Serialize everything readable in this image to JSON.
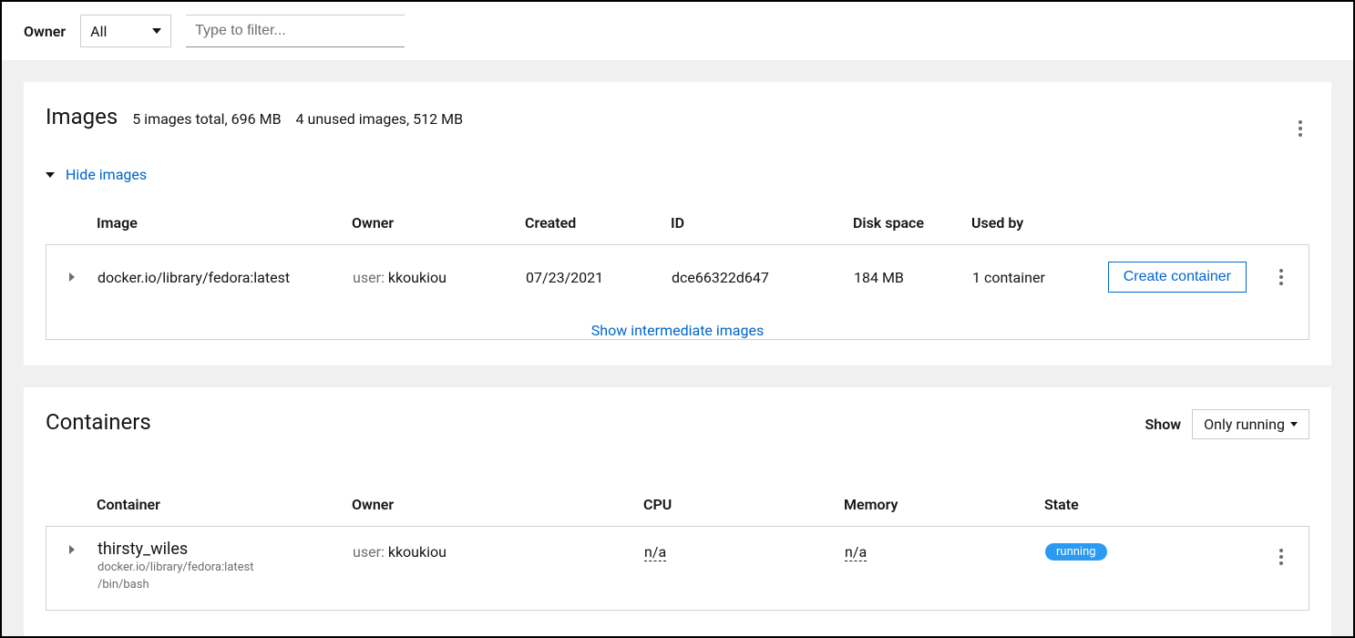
{
  "toolbar": {
    "owner_label": "Owner",
    "owner_value": "All",
    "filter_placeholder": "Type to filter..."
  },
  "images": {
    "title": "Images",
    "summary_total": "5 images total, 696 MB",
    "summary_unused": "4 unused images, 512 MB",
    "hide_label": "Hide images",
    "columns": {
      "image": "Image",
      "owner": "Owner",
      "created": "Created",
      "id": "ID",
      "disk": "Disk space",
      "usedby": "Used by"
    },
    "rows": [
      {
        "image": "docker.io/library/fedora:latest",
        "owner_prefix": "user: ",
        "owner_name": "kkoukiou",
        "created": "07/23/2021",
        "id": "dce66322d647",
        "disk": "184 MB",
        "usedby": "1 container",
        "action_label": "Create container"
      }
    ],
    "show_intermediate": "Show intermediate images"
  },
  "containers": {
    "title": "Containers",
    "show_label": "Show",
    "show_value": "Only running",
    "columns": {
      "container": "Container",
      "owner": "Owner",
      "cpu": "CPU",
      "memory": "Memory",
      "state": "State"
    },
    "rows": [
      {
        "name": "thirsty_wiles",
        "sub_image": "docker.io/library/fedora:latest",
        "sub_cmd": "/bin/bash",
        "owner_prefix": "user: ",
        "owner_name": "kkoukiou",
        "cpu": "n/a",
        "memory": "n/a",
        "state": "running"
      }
    ]
  }
}
